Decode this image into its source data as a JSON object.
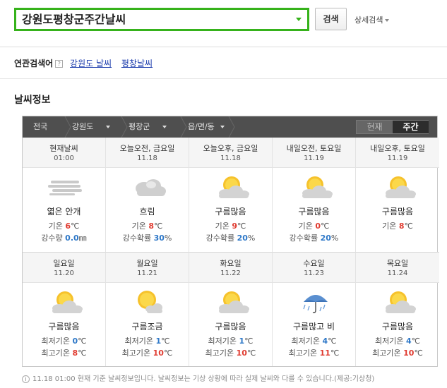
{
  "search": {
    "query": "강원도평창군주간날씨",
    "button": "검색",
    "advanced": "상세검색"
  },
  "related": {
    "label": "연관검색어",
    "help": "?",
    "links": [
      "강원도 날씨",
      "평창날씨"
    ]
  },
  "section_title": "날씨정보",
  "nav": {
    "crumbs": [
      "전국",
      "강원도",
      "평창군",
      "읍/면/동"
    ],
    "tab_now": "현재",
    "tab_week": "주간"
  },
  "colors": {
    "search_border": "#36b21b",
    "temp_red": "#e03c31",
    "rain_blue": "#2e78c8",
    "nav_bg": "#4f4f4f"
  },
  "row1": [
    {
      "day": "현재날씨",
      "date": "01:00",
      "icon": "fog-icon",
      "cond": "엷은 안개",
      "l1_label": "기온 ",
      "l1_val": "6",
      "l1_unit": "℃",
      "l2_label": "강수량 ",
      "l2_val": "0.0",
      "l2_unit": "㎜"
    },
    {
      "day": "오늘오전, 금요일",
      "date": "11.18",
      "icon": "cloudy-icon",
      "cond": "흐림",
      "l1_label": "기온 ",
      "l1_val": "8",
      "l1_unit": "℃",
      "l2_label": "강수확률 ",
      "l2_val": "30",
      "l2_unit": "%"
    },
    {
      "day": "오늘오후, 금요일",
      "date": "11.18",
      "icon": "partly-cloudy-icon",
      "cond": "구름많음",
      "l1_label": "기온 ",
      "l1_val": "9",
      "l1_unit": "℃",
      "l2_label": "강수확률 ",
      "l2_val": "20",
      "l2_unit": "%"
    },
    {
      "day": "내일오전, 토요일",
      "date": "11.19",
      "icon": "partly-cloudy-icon",
      "cond": "구름많음",
      "l1_label": "기온 ",
      "l1_val": "0",
      "l1_unit": "℃",
      "l2_label": "강수확률 ",
      "l2_val": "20",
      "l2_unit": "%"
    },
    {
      "day": "내일오후, 토요일",
      "date": "11.19",
      "icon": "partly-cloudy-icon",
      "cond": "구름많음",
      "l1_label": "기온 ",
      "l1_val": "8",
      "l1_unit": "℃",
      "l2_label": "",
      "l2_val": "",
      "l2_unit": ""
    }
  ],
  "row2": [
    {
      "day": "일요일",
      "date": "11.20",
      "icon": "partly-cloudy-icon",
      "cond": "구름많음",
      "min": "0",
      "max": "8"
    },
    {
      "day": "월요일",
      "date": "11.21",
      "icon": "sun-small-cloud-icon",
      "cond": "구름조금",
      "min": "1",
      "max": "10"
    },
    {
      "day": "화요일",
      "date": "11.22",
      "icon": "partly-cloudy-icon",
      "cond": "구름많음",
      "min": "1",
      "max": "10"
    },
    {
      "day": "수요일",
      "date": "11.23",
      "icon": "rain-umbrella-icon",
      "cond": "구름많고 비",
      "min": "4",
      "max": "11"
    },
    {
      "day": "목요일",
      "date": "11.24",
      "icon": "partly-cloudy-icon",
      "cond": "구름많음",
      "min": "4",
      "max": "10"
    }
  ],
  "labels": {
    "min": "최저기온 ",
    "max": "최고기온 ",
    "unit": "℃"
  },
  "footnote": "11.18 01:00 현재 기준 날씨정보입니다. 날씨정보는 기상 상황에 따라 실제 날씨와 다를 수 있습니다.(제공:기상청)"
}
